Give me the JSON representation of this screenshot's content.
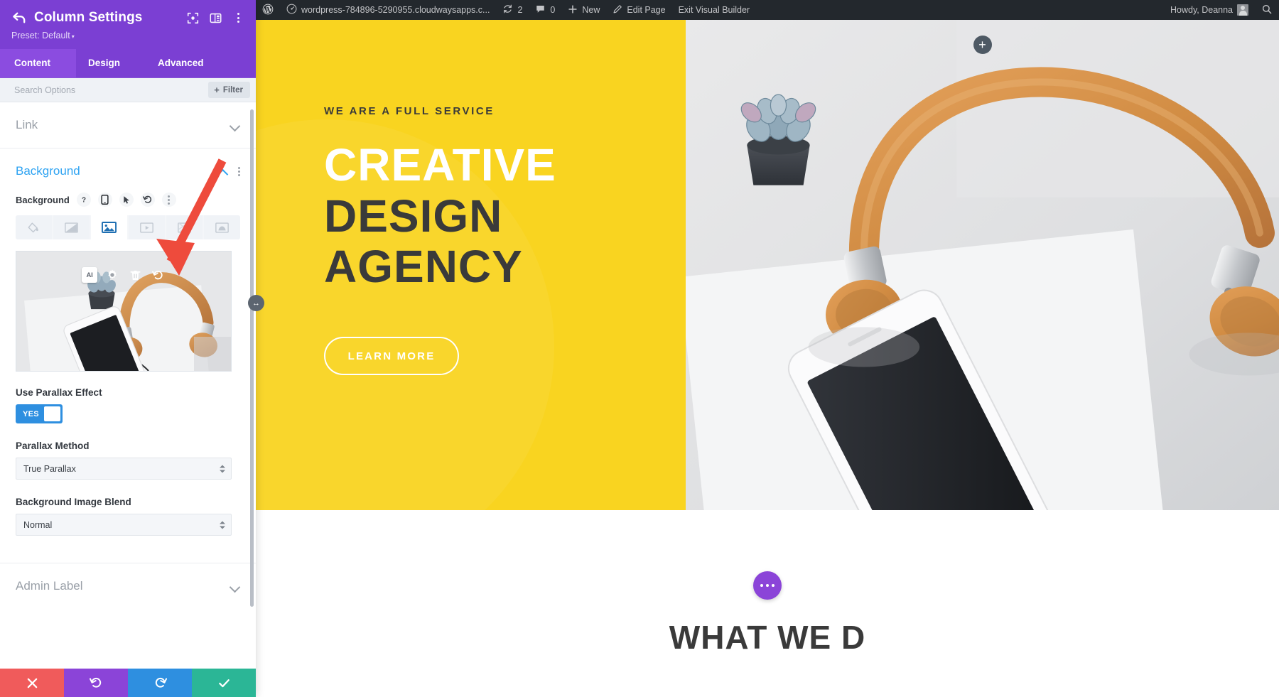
{
  "panel": {
    "title": "Column Settings",
    "back_icon": "back-arrow-icon",
    "preset_label": "Preset: Default",
    "header_icons": [
      "focus-target-icon",
      "panel-layout-icon",
      "kebab-menu-icon"
    ],
    "tabs": [
      {
        "label": "Content",
        "active": true
      },
      {
        "label": "Design",
        "active": false
      },
      {
        "label": "Advanced",
        "active": false
      }
    ],
    "search": {
      "placeholder": "Search Options",
      "value": ""
    },
    "filter_button": {
      "label": "Filter",
      "plus": "+"
    },
    "sections": [
      {
        "label": "Link",
        "open": false
      },
      {
        "label": "Background",
        "open": true
      },
      {
        "label": "Admin Label",
        "open": false
      }
    ],
    "background": {
      "field_label": "Background",
      "control_icons": [
        "help-icon",
        "responsive-mobile-icon",
        "hover-cursor-icon",
        "reset-undo-icon",
        "kebab-menu-icon"
      ],
      "type_tabs": [
        {
          "name": "background-color-tab",
          "active": false
        },
        {
          "name": "background-gradient-tab",
          "active": false
        },
        {
          "name": "background-image-tab",
          "active": true
        },
        {
          "name": "background-video-tab",
          "active": false
        },
        {
          "name": "background-pattern-tab",
          "active": false
        },
        {
          "name": "background-mask-tab",
          "active": false
        }
      ],
      "image_actions": [
        "ai-generate-button",
        "image-settings-gear-icon",
        "delete-trash-icon",
        "reset-undo-icon"
      ],
      "ai_label": "AI",
      "parallax_toggle": {
        "label": "Use Parallax Effect",
        "value": "YES"
      },
      "parallax_method": {
        "label": "Parallax Method",
        "value": "True Parallax"
      },
      "image_blend": {
        "label": "Background Image Blend",
        "value": "Normal"
      }
    },
    "footer_buttons": [
      {
        "name": "cancel-button",
        "icon": "close-x-icon",
        "color": "#F05B5B"
      },
      {
        "name": "undo-button",
        "icon": "undo-icon",
        "color": "#8B44D8"
      },
      {
        "name": "redo-button",
        "icon": "redo-icon",
        "color": "#2E8FE0"
      },
      {
        "name": "save-button",
        "icon": "checkmark-icon",
        "color": "#2BB696"
      }
    ]
  },
  "adminbar": {
    "wp_logo": "wordpress-logo-icon",
    "site_name": "wordpress-784896-5290955.cloudwaysapps.c...",
    "updates": {
      "icon": "updates-refresh-icon",
      "count": "2"
    },
    "comments": {
      "icon": "comment-bubble-icon",
      "count": "0"
    },
    "new": {
      "icon": "plus-icon",
      "label": "New"
    },
    "edit_page": {
      "icon": "pencil-edit-icon",
      "label": "Edit Page"
    },
    "exit_builder": {
      "label": "Exit Visual Builder"
    },
    "howdy": "Howdy, Deanna",
    "avatar": "user-avatar",
    "search": "search-icon"
  },
  "canvas": {
    "hero": {
      "eyebrow": "WE ARE A FULL SERVICE",
      "heading_line1": "CREATIVE",
      "heading_line2": "DESIGN",
      "heading_line3": "AGENCY",
      "cta_label": "LEARN MORE",
      "bg_color": "#F9D420",
      "add_module_label": "+"
    },
    "below": {
      "title": "WHAT WE D",
      "row_menu_icon": "row-settings-dots-icon"
    }
  },
  "resize_handle": {
    "name": "panel-resize-handle",
    "icon": "↔"
  },
  "annotation": {
    "name": "red-arrow-annotation",
    "color": "#EE4B3C"
  },
  "colors": {
    "panel_purple": "#7B3FD3",
    "accent_blue": "#2EA3F2",
    "hero_yellow": "#F9D420",
    "adminbar_dark": "#23282D"
  }
}
